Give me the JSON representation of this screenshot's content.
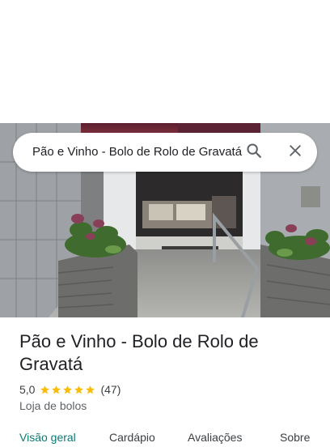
{
  "search": {
    "query": "Pão e Vinho - Bolo de Rolo de Gravatá"
  },
  "place": {
    "name": "Pão e Vinho - Bolo de Rolo de Gravatá",
    "rating": "5,0",
    "stars": 5,
    "review_count": "(47)",
    "category": "Loja de bolos"
  },
  "tabs": [
    {
      "label": "Visão geral",
      "active": true
    },
    {
      "label": "Cardápio",
      "active": false
    },
    {
      "label": "Avaliações",
      "active": false
    },
    {
      "label": "Sobre",
      "active": false
    }
  ],
  "colors": {
    "star": "#fbbc04",
    "active_tab": "#0b7a75"
  },
  "icons": {
    "search": "search-icon",
    "close": "close-icon",
    "star": "star-icon"
  }
}
